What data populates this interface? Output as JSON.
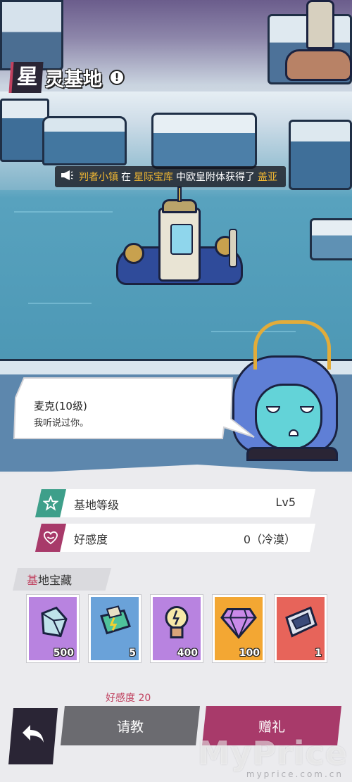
{
  "header": {
    "title_first": "星",
    "title_rest": "灵基地",
    "info_icon": "exclamation-icon"
  },
  "ticker": {
    "icon": "megaphone-icon",
    "player": "判者小镇",
    "word_in": "在",
    "place": "星际宝库",
    "middle": "中欧皇附体获得了",
    "reward": "盖亚"
  },
  "dialogue": {
    "speaker": "麦克(10级)",
    "line": "我听说过你。"
  },
  "stats": {
    "level_label": "基地等级",
    "level_value": "Lv5",
    "level_icon": "star-icon",
    "affinity_label": "好感度",
    "affinity_value": "0（冷漠）",
    "affinity_icon": "heart-icon"
  },
  "treasure": {
    "title_first": "基",
    "title_rest": "地宝藏",
    "items": [
      {
        "icon": "ice-crystal-icon",
        "count": "500",
        "color": "#b883e0"
      },
      {
        "icon": "circuit-board-icon",
        "count": "5",
        "color": "#6aa2d9"
      },
      {
        "icon": "light-bulb-icon",
        "count": "400",
        "color": "#b883e0"
      },
      {
        "icon": "diamond-icon",
        "count": "100",
        "color": "#f3a733"
      },
      {
        "icon": "ticket-icon",
        "count": "1",
        "color": "#e7645a"
      }
    ]
  },
  "actions": {
    "affinity_requirement": "好感度 20",
    "ask_label": "请教",
    "gift_label": "赠礼",
    "back_icon": "back-arrow-icon"
  },
  "watermark": {
    "brand": "MyPrice",
    "url": "myprice.com.cn"
  },
  "colors": {
    "accent_pink": "#c0415f",
    "gift_button": "#a83a6a",
    "ask_button": "#6b6b70",
    "ticker_highlight": "#f2b832"
  }
}
